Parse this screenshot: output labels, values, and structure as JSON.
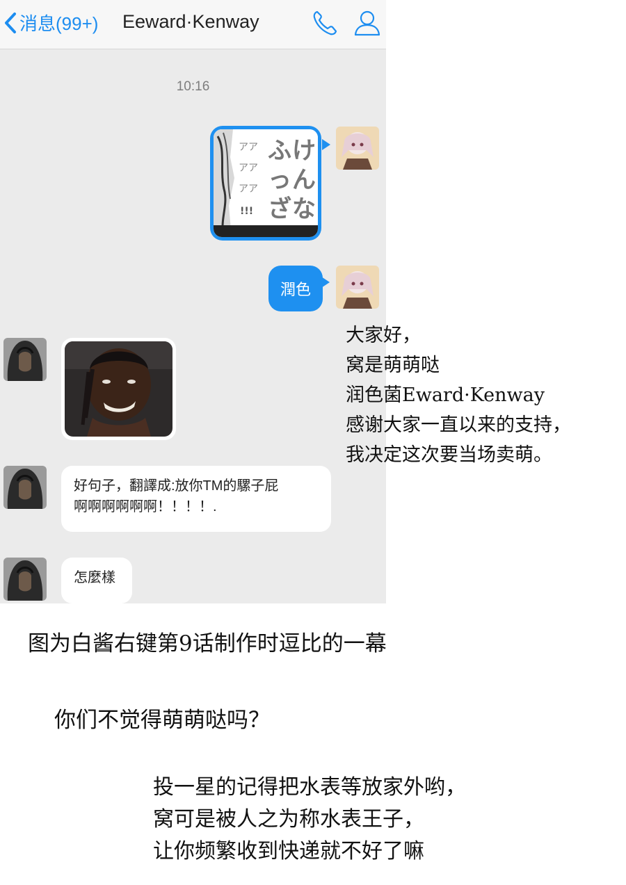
{
  "header": {
    "back_label": "消息(99+)",
    "title": "Eeward·Kenway",
    "icons": [
      "chevron-left-icon",
      "phone-icon",
      "person-icon"
    ]
  },
  "chat": {
    "timestamp": "10:16",
    "messages": [
      {
        "side": "right",
        "type": "image",
        "image_text_large": "ふっざけんな",
        "image_text_small": "アアアアアアア!!!"
      },
      {
        "side": "right",
        "type": "text",
        "text": "潤色"
      },
      {
        "side": "left",
        "type": "image",
        "image_desc": "smiling-man-photo"
      },
      {
        "side": "left",
        "type": "text",
        "lines": [
          "好句子，翻譯成:放你TM的騾子屁",
          "啊啊啊啊啊啊！！！！."
        ]
      },
      {
        "side": "left",
        "type": "text",
        "text": "怎麼樣"
      }
    ]
  },
  "side_note": {
    "lines": [
      "大家好，",
      "窝是萌萌哒",
      "润色菌Eward·Kenway",
      "感谢大家一直以来的支持，",
      "我决定这次要当场卖萌。"
    ]
  },
  "captions": {
    "line1": "图为白酱右键第9话制作时逗比的一幕",
    "line2": "你们不觉得萌萌哒吗？",
    "para": [
      "投一星的记得把水表等放家外哟，",
      "窝可是被人之为称水表王子，",
      "让你频繁收到快递就不好了嘛"
    ]
  },
  "colors": {
    "accent": "#1e90f0",
    "chat_bg": "#ebebeb"
  }
}
